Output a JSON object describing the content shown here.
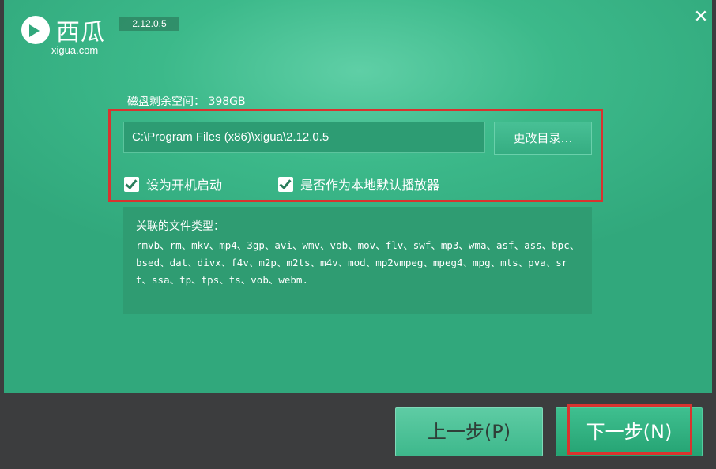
{
  "app": {
    "name": "西瓜",
    "domain": "xigua.com",
    "version": "2.12.0.5",
    "close_glyph": "✕"
  },
  "install": {
    "disk_space_label": "磁盘剩余空间：",
    "disk_space_value": "398GB",
    "path_value": "C:\\Program Files (x86)\\xigua\\2.12.0.5",
    "browse_label": "更改目录…",
    "option_autostart": {
      "label": "设为开机启动",
      "checked": true
    },
    "option_default_player": {
      "label": "是否作为本地默认播放器",
      "checked": true
    }
  },
  "file_types": {
    "title": "关联的文件类型：",
    "list": "rmvb、rm、mkv、mp4、3gp、avi、wmv、vob、mov、flv、swf、mp3、wma、asf、ass、bpc、bsed、dat、divx、f4v、m2p、m2ts、m4v、mod、mp2vmpeg、mpeg4、mpg、mts、pva、srt、ssa、tp、tps、ts、vob、webm."
  },
  "nav": {
    "prev_label": "上一步(P)",
    "next_label": "下一步(N)"
  },
  "colors": {
    "accent": "#31a87c",
    "highlight_border": "#d9332f",
    "footer": "#3c3d3e"
  }
}
